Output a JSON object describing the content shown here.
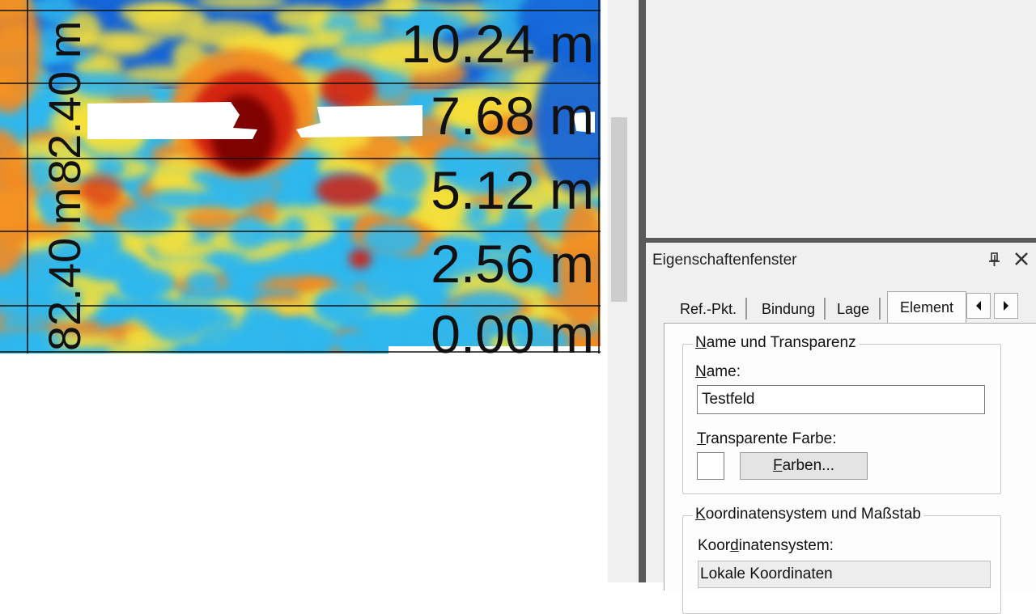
{
  "map": {
    "scale_labels": [
      "10.24 m",
      "7.68 m",
      "5.12 m",
      "2.56 m",
      "0.00 m"
    ],
    "vertical_labels": [
      "82.40 m",
      "82.40 m"
    ],
    "colors": {
      "low": "#1565d8",
      "mid_low": "#2fb8ee",
      "mid": "#f7e03a",
      "mid_high": "#f38a20",
      "high": "#d42010",
      "peak": "#7a0000"
    }
  },
  "properties_panel": {
    "title": "Eigenschaftenfenster",
    "pin_icon": "pin-icon",
    "close_icon": "close-icon",
    "tabs": [
      {
        "label": "Ref.-Pkt."
      },
      {
        "label": "Bindung"
      },
      {
        "label": "Lage"
      },
      {
        "label": "Element",
        "active": true
      }
    ],
    "tab_scroll_icons": [
      "arrow-left-icon",
      "arrow-right-icon"
    ],
    "group_name": {
      "legend_first": "N",
      "legend_rest": "ame und Transparenz",
      "name_label_first": "N",
      "name_label_rest": "ame:",
      "name_value": "Testfeld",
      "transparent_label_first": "T",
      "transparent_label_rest": "ransparente Farbe:",
      "colors_button_first": "F",
      "colors_button_rest": "arben..."
    },
    "group_coords": {
      "legend_first": "K",
      "legend_rest": "oordinatensystem und Maßstab",
      "system_label_prefix": "Koor",
      "system_label_u": "d",
      "system_label_rest": "inatensystem:",
      "system_value": "Lokale Koordinaten"
    }
  }
}
